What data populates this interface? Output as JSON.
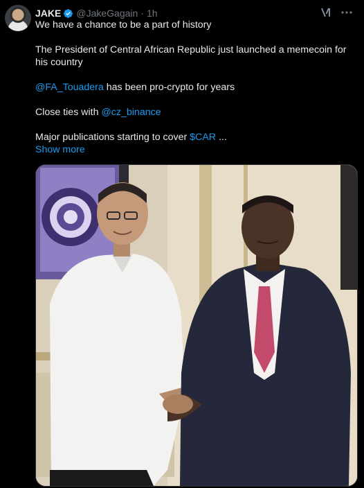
{
  "author": {
    "name": "JAKE",
    "handle": "@JakeGagain",
    "separator": "·",
    "time": "1h"
  },
  "icons": {
    "verified": "verified-badge-icon",
    "grok": "grok-icon",
    "more": "more-options-icon"
  },
  "tweet": {
    "line1": "We have a chance to be a part of history",
    "line2": "The President of Central African Republic just launched a memecoin for his country",
    "line3_mention": "@FA_Touadera",
    "line3_rest": " has been pro-crypto for years",
    "line4_prefix": "Close ties with ",
    "line4_mention": "@cz_binance",
    "line5_prefix": "Major publications starting to cover ",
    "line5_cashtag": "$CAR",
    "line5_suffix": " ...",
    "show_more": "Show more"
  },
  "colors": {
    "background": "#000000",
    "text": "#e7e9ea",
    "muted": "#71767b",
    "link": "#1d9bf0"
  }
}
